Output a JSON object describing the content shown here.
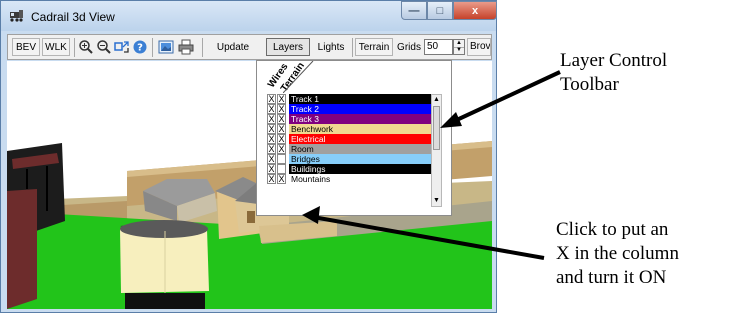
{
  "window": {
    "title": "Cadrail 3d View",
    "min_label": "—",
    "max_label": "□",
    "close_label": "x"
  },
  "toolbar": {
    "bev_label": "BEV",
    "wlk_label": "WLK",
    "update_label": "Update",
    "layers_label": "Layers",
    "lights_label": "Lights",
    "terrain_label": "Terrain",
    "grids_label": "Grids",
    "grids_value": "50",
    "browse_label": "Brov"
  },
  "layer_panel": {
    "col_wires": "Wires",
    "col_terrain": "Terrain",
    "layers": [
      {
        "name": "Track 1",
        "wires": "X",
        "terrain": "X",
        "bg": "#000000",
        "fg": "#ffffff"
      },
      {
        "name": "Track 2",
        "wires": "X",
        "terrain": "X",
        "bg": "#0000ff",
        "fg": "#ffffff"
      },
      {
        "name": "Track 3",
        "wires": "X",
        "terrain": "X",
        "bg": "#800080",
        "fg": "#ffffff"
      },
      {
        "name": "Benchwork",
        "wires": "X",
        "terrain": "X",
        "bg": "#f0d890",
        "fg": "#000000"
      },
      {
        "name": "Electrical",
        "wires": "X",
        "terrain": "X",
        "bg": "#ff0000",
        "fg": "#ffffff"
      },
      {
        "name": "Room",
        "wires": "X",
        "terrain": "X",
        "bg": "#a0a0a0",
        "fg": "#000000"
      },
      {
        "name": "Bridges",
        "wires": "X",
        "terrain": "",
        "bg": "#87cefa",
        "fg": "#000000"
      },
      {
        "name": "Buildings",
        "wires": "X",
        "terrain": "",
        "bg": "#000000",
        "fg": "#ffffff"
      },
      {
        "name": "Mountains",
        "wires": "X",
        "terrain": "X",
        "bg": "#ffffff",
        "fg": "#000000"
      }
    ]
  },
  "annotations": {
    "layer_control": [
      "Layer Control",
      "Toolbar"
    ],
    "click_hint": [
      "Click to put an",
      "X in the column",
      "and turn it ON"
    ]
  }
}
